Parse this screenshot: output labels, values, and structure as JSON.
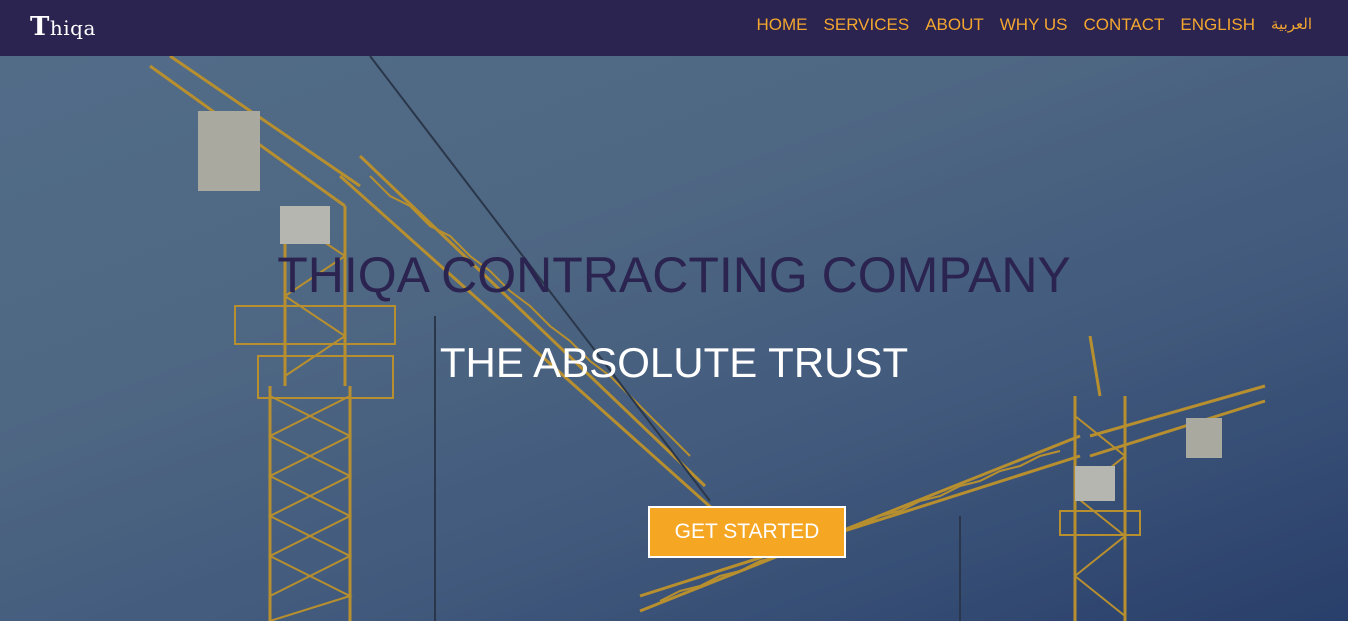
{
  "brand": {
    "logo_big": "T",
    "logo_rest": "hiqa"
  },
  "nav": {
    "items": [
      {
        "label": "HOME"
      },
      {
        "label": "SERVICES"
      },
      {
        "label": "ABOUT"
      },
      {
        "label": "WHY US"
      },
      {
        "label": "CONTACT"
      },
      {
        "label": "ENGLISH"
      },
      {
        "label": "العربية"
      }
    ]
  },
  "hero": {
    "title": "THIQA CONTRACTING COMPANY",
    "subtitle": "THE ABSOLUTE TRUST",
    "cta_label": "GET STARTED"
  },
  "colors": {
    "navbar_bg": "#2b2350",
    "nav_link": "#f3a72f",
    "title": "#2b2350",
    "cta_bg": "#f5a623",
    "crane": "#d9a72a"
  }
}
